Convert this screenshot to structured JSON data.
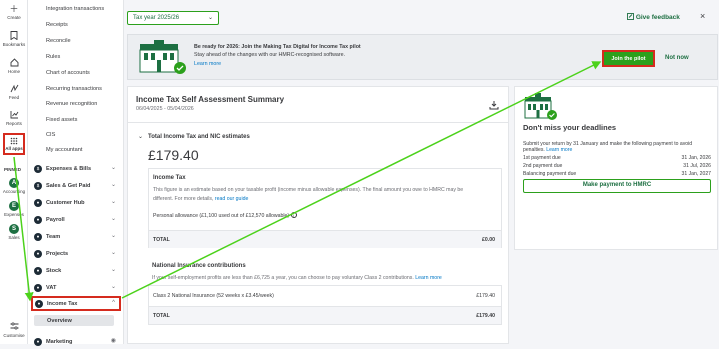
{
  "rail": {
    "items": [
      {
        "icon": "plus-icon",
        "label": "Create"
      },
      {
        "icon": "bookmark-icon",
        "label": "Bookmarks"
      },
      {
        "icon": "home-icon",
        "label": "Home"
      },
      {
        "icon": "feed-icon",
        "label": "Feed"
      },
      {
        "icon": "reports-icon",
        "label": "Reports"
      },
      {
        "icon": "grid-icon",
        "label": "All apps"
      }
    ],
    "pinned_label": "PINNED",
    "pinned": [
      {
        "letter": "A",
        "label": "Accounting"
      },
      {
        "letter": "E",
        "label": "Expenses"
      },
      {
        "letter": "S",
        "label": "Sales"
      }
    ],
    "customise": "Customise"
  },
  "subnav": {
    "items": [
      "Integration transactions",
      "Receipts",
      "Reconcile",
      "Rules",
      "Chart of accounts",
      "Recurring transactions",
      "Revenue recognition",
      "Fixed assets",
      "CIS",
      "My accountant"
    ],
    "groups": [
      {
        "label": "Expenses & Bills",
        "chevron": "⌄"
      },
      {
        "label": "Sales & Get Paid",
        "chevron": "⌄"
      },
      {
        "label": "Customer Hub",
        "chevron": "⌄"
      },
      {
        "label": "Payroll",
        "chevron": "⌄"
      },
      {
        "label": "Team",
        "chevron": "⌄"
      },
      {
        "label": "Projects",
        "chevron": "⌄"
      },
      {
        "label": "Stock",
        "chevron": "⌄"
      },
      {
        "label": "VAT",
        "chevron": "⌄"
      },
      {
        "label": "Income Tax",
        "chevron": "^"
      }
    ],
    "active_sub": "Overview",
    "marketing": "Marketing"
  },
  "topbar": {
    "tax_year": "Tax year 2025/26",
    "feedback": "Give feedback"
  },
  "banner": {
    "title": "Be ready for 2026: Join the Making Tax Digital for Income Tax pilot",
    "subtitle": "Stay ahead of the changes with our HMRC-recognised software.",
    "link": "Learn more",
    "join": "Join the pilot",
    "not_now": "Not now"
  },
  "summary": {
    "title": "Income Tax Self Assessment Summary",
    "dates": "06/04/2025 - 05/04/2026",
    "estimates_label": "Total Income Tax and NIC estimates",
    "total": "£179.40",
    "income_tax": {
      "title": "Income Tax",
      "text1": "This figure is an estimate based on your taxable profit (income minus allowable expenses). The final amount you owe to HMRC may be",
      "text2": "different. For more details,",
      "link": "read our guide",
      "allowance": "Personal allowance (£1,100 used out of £12,570 allowable)",
      "total_label": "TOTAL",
      "total_value": "£0.00"
    },
    "ni": {
      "title": "National Insurance contributions",
      "text": "If your self-employment profits are less than £6,725 a year, you can choose to pay voluntary Class 2 contributions.",
      "link": "Learn more",
      "class2_label": "Class 2 National Insurance (52 weeks x £3.45/week)",
      "class2_value": "£179.40",
      "total_label": "TOTAL",
      "total_value": "£179.40"
    }
  },
  "deadlines": {
    "title": "Don't miss your deadlines",
    "text": "Submit your return by 31 January and make the following payment to avoid penalties.",
    "link": "Learn more",
    "rows": [
      {
        "label": "1st payment due",
        "value": "31 Jan, 2026"
      },
      {
        "label": "2nd payment due",
        "value": "31 Jul, 2026"
      },
      {
        "label": "Balancing payment due",
        "value": "31 Jan, 2027"
      }
    ],
    "button": "Make payment to HMRC"
  },
  "colors": {
    "green": "#2ca01c",
    "dark_green": "#1d6f42",
    "link_blue": "#0077c5",
    "annotation_red": "#d52b1e",
    "annotation_arrow": "#4cd21b"
  }
}
